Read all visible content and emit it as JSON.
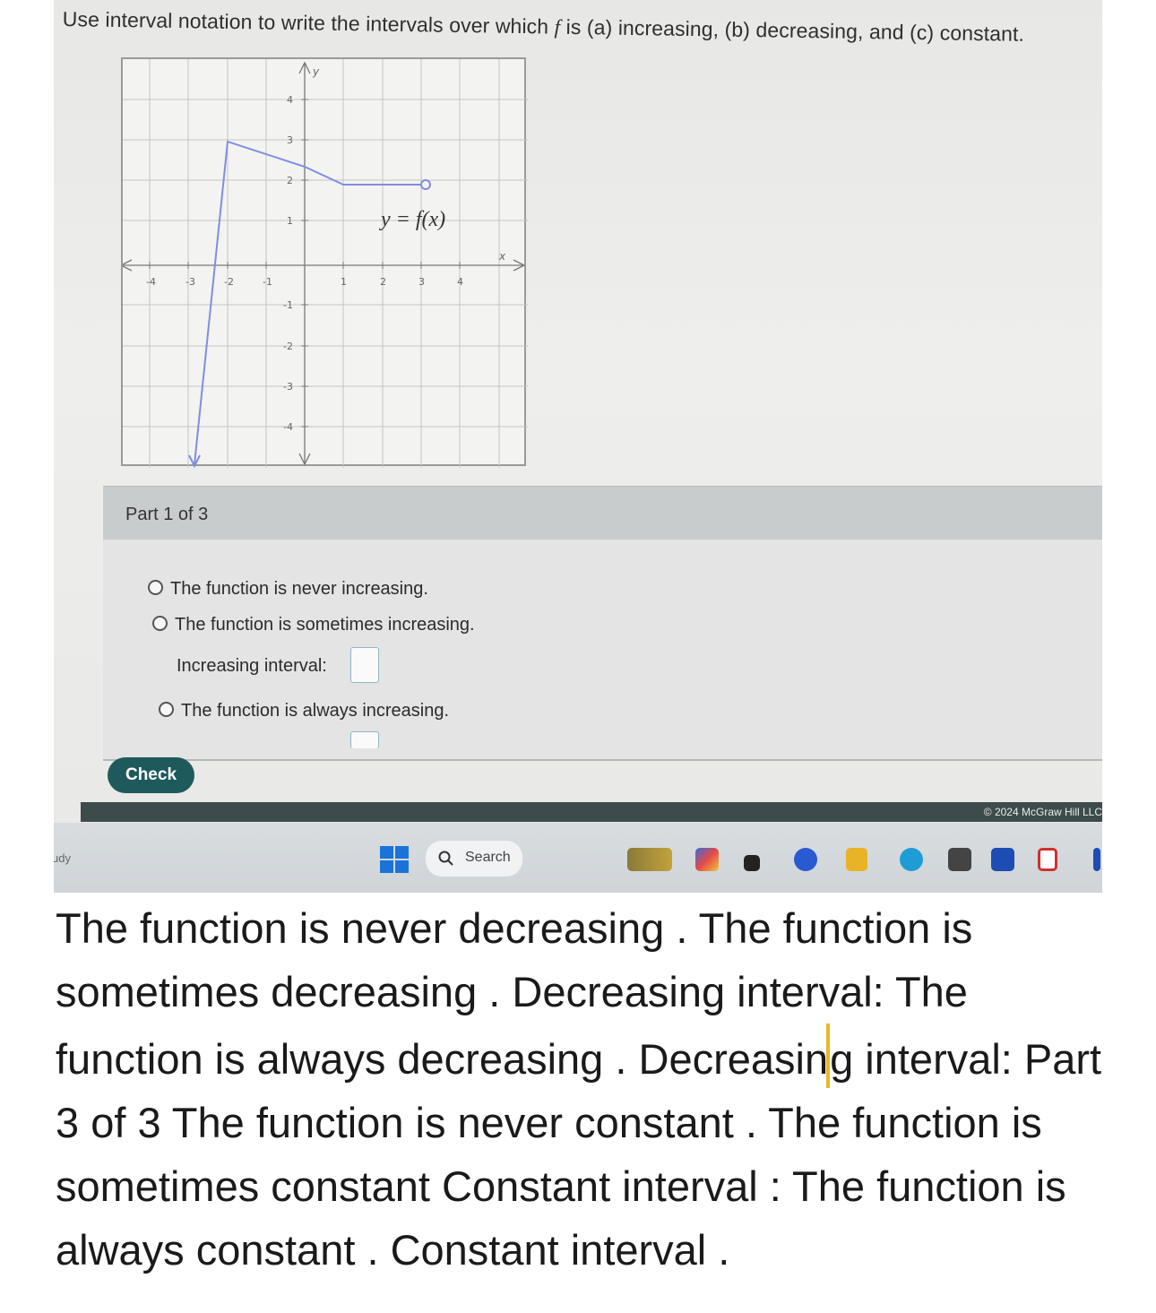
{
  "question": {
    "prefix": "Use interval notation to write the intervals over which ",
    "f": "f",
    "suffix": " is (a) increasing, (b) decreasing, and (c) constant."
  },
  "graph": {
    "func_label": "y = f(x)",
    "x_axis_label": "x",
    "y_axis_label": "y",
    "x_ticks": [
      "-4",
      "-3",
      "-2",
      "-1",
      "1",
      "2",
      "3",
      "4"
    ],
    "y_ticks": [
      "4",
      "3",
      "2",
      "1",
      "-1",
      "-2",
      "-3",
      "-4"
    ]
  },
  "part": {
    "label": "Part 1 of 3"
  },
  "options": {
    "never": "The function is never increasing.",
    "sometimes": "The function is sometimes increasing.",
    "interval_label": "Increasing interval:",
    "always": "The function is always increasing."
  },
  "palette": {
    "open_interval": "(□,□)",
    "infinity": "∞",
    "neg_infinity": "-∞",
    "union": "□∪□",
    "clear": "×",
    "undo": "↺"
  },
  "check_button": "Check",
  "copyright": "© 2024 McGraw Hill LLC",
  "taskbar": {
    "study": "udy",
    "search": "Search"
  },
  "answer": {
    "text_before_caret": "The function is never decreasing . The function is sometimes decreasing . Decreasing interval: The function is always decreasing . Decreasin",
    "text_after_caret": "g interval: Part 3 of 3 The function is never constant . The function is sometimes constant Constant interval : The function is always constant . Constant interval ."
  },
  "colors": {
    "accent": "#1e6f80",
    "check": "#1e5a5c",
    "graph_line": "#7f8ee0",
    "caret": "#f0b429"
  }
}
